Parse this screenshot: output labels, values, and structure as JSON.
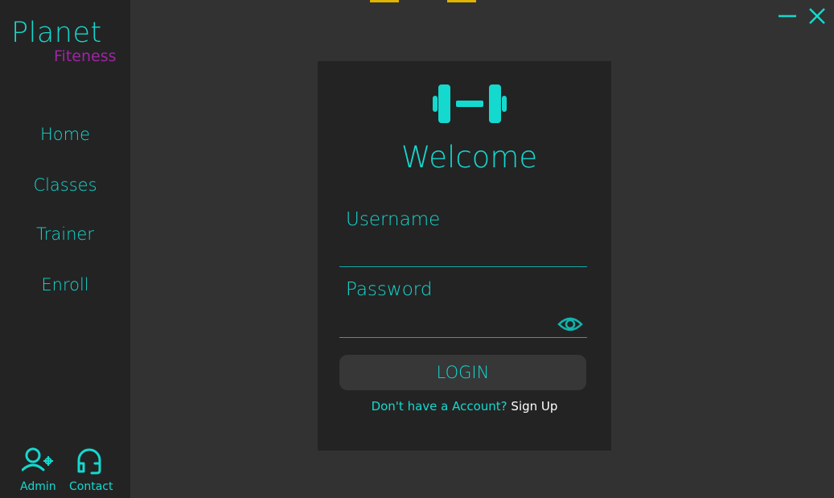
{
  "brand": {
    "name": "Planet",
    "subname": "Fiteness"
  },
  "nav": {
    "items": [
      {
        "label": "Home"
      },
      {
        "label": "Classes"
      },
      {
        "label": "Trainer"
      },
      {
        "label": "Enroll"
      }
    ]
  },
  "footer": {
    "admin_label": "Admin",
    "contact_label": "Contact",
    "admin_icon": "user-gear-icon",
    "contact_icon": "headset-icon"
  },
  "window_controls": {
    "minimize_icon": "minimize-icon",
    "close_icon": "close-icon"
  },
  "login": {
    "logo_icon": "dumbbell-icon",
    "title": "Welcome",
    "username_label": "Username",
    "username_value": "",
    "password_label": "Password",
    "password_value": "",
    "show_password_icon": "eye-icon",
    "button_label": "LOGIN",
    "signup_prompt": "Don't have a Account?",
    "signup_link": "Sign Up"
  },
  "colors": {
    "accent": "#14d9cf",
    "brand_secondary": "#a024a6",
    "background": "#323232",
    "panel": "#232323",
    "button": "#373737",
    "top_accent": "#e0b400"
  }
}
